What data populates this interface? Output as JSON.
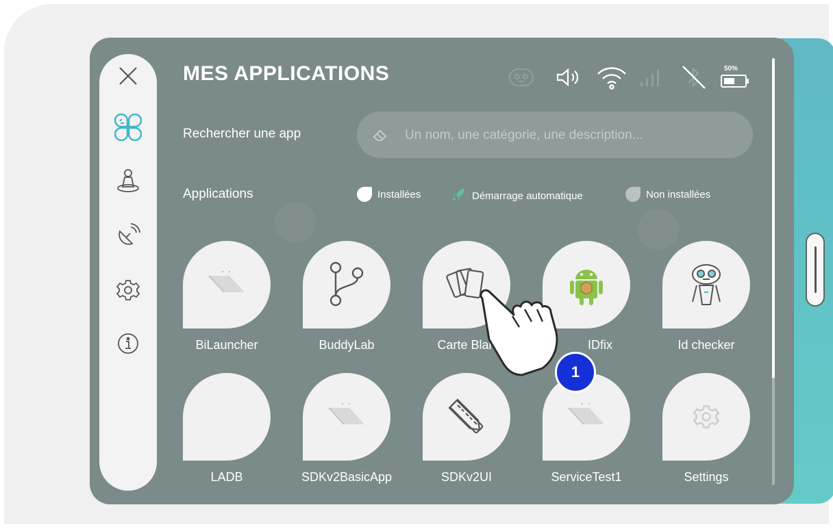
{
  "header": {
    "title": "MES APPLICATIONS",
    "battery_label": "50%"
  },
  "search": {
    "label": "Rechercher une app",
    "placeholder": "Un nom, une catégorie, une description..."
  },
  "apps_section": {
    "label": "Applications"
  },
  "legend": {
    "installed": "Installées",
    "autostart": "Démarrage automatique",
    "not_installed": "Non installées"
  },
  "sidebar": {
    "items": [
      {
        "icon": "close-icon"
      },
      {
        "icon": "apps-icon"
      },
      {
        "icon": "robot-figure-icon"
      },
      {
        "icon": "satellite-dish-icon"
      },
      {
        "icon": "gear-icon"
      },
      {
        "icon": "info-icon"
      }
    ]
  },
  "apps": [
    {
      "label": "BiLauncher",
      "icon": "placeholder-icon"
    },
    {
      "label": "BuddyLab",
      "icon": "branch-icon"
    },
    {
      "label": "Carte Blan",
      "icon": "cards-icon"
    },
    {
      "label": "IDfix",
      "icon": "android-icon"
    },
    {
      "label": "Id checker",
      "icon": "buddy-robot-icon"
    },
    {
      "label": "LADB",
      "icon": "blank-icon"
    },
    {
      "label": "SDKv2BasicApp",
      "icon": "placeholder-icon"
    },
    {
      "label": "SDKv2UI",
      "icon": "design-tools-icon"
    },
    {
      "label": "ServiceTest1",
      "icon": "placeholder-icon"
    },
    {
      "label": "Settings",
      "icon": "gear-icon"
    }
  ],
  "annotation": {
    "step": "1"
  },
  "colors": {
    "panel": "#7b8b8a",
    "accent": "#4bb8c8",
    "badge": "#1530d6"
  }
}
